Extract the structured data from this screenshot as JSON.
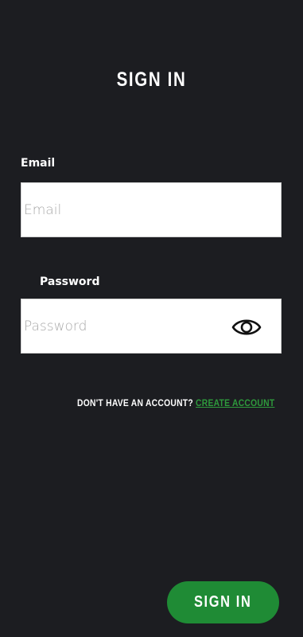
{
  "page": {
    "title": "SIGN IN"
  },
  "form": {
    "email": {
      "label": "Email",
      "placeholder": "Email",
      "value": ""
    },
    "password": {
      "label": "Password",
      "placeholder": "Password",
      "value": "",
      "toggle_icon": "eye-icon"
    }
  },
  "signup": {
    "prompt": "DON'T HAVE AN ACCOUNT?",
    "link_label": "CREATE ACCOUNT"
  },
  "actions": {
    "signin_label": "SIGN IN"
  },
  "colors": {
    "background": "#1c1d21",
    "accent": "#1f8b35",
    "link": "#2e9a3c",
    "input_background": "#ffffff"
  }
}
